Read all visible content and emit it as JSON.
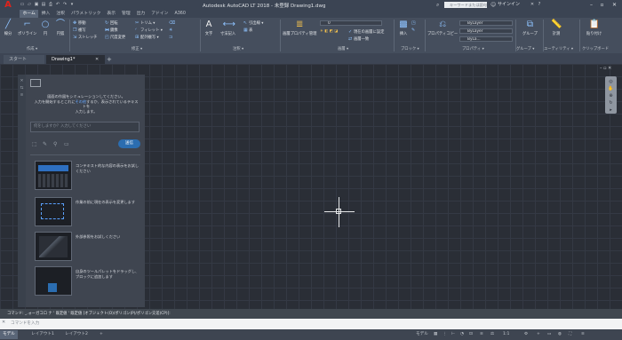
{
  "app": {
    "title": "Autodesk AutoCAD LT 2018 - 未登録  Drawing1.dwg",
    "search_placeholder": "キーワードまたは語句を入力",
    "signin": "サインイン",
    "colors": {
      "titlebar": "#3b4453",
      "ribbon": "#454e5d",
      "canvas": "#2a2e36",
      "accent": "#2b6db0",
      "logo": "#e0231c"
    }
  },
  "ribbon_tabs": [
    "ホーム",
    "挿入",
    "注釈",
    "パラメトリック",
    "表示",
    "管理",
    "出力",
    "アドイン",
    "A360"
  ],
  "ribbon": {
    "draw": {
      "title": "作成 ▾",
      "line": "線分",
      "polyline": "ポリライン",
      "circle": "円",
      "arc": "円弧"
    },
    "modify": {
      "title": "修正 ▾",
      "items": [
        "移動",
        "回転",
        "トリム ▾",
        "複写",
        "鏡像",
        "フィレット ▾",
        "ストレッチ",
        "尺度変更",
        "配列複写 ▾"
      ]
    },
    "annotation": {
      "title": "注釈 ▾",
      "text": "文字",
      "dimension": "寸法記入",
      "items": [
        "引出線 ▾",
        "表"
      ]
    },
    "layers": {
      "title": "画層 ▾",
      "layer_properties": "画層プロパティ管理",
      "current_layer": "0",
      "items": [
        "現在の画層に設定",
        "画層一致"
      ]
    },
    "block": {
      "title": "ブロック ▾",
      "insert": "挿入"
    },
    "properties": {
      "title": "プロパティ ▾",
      "match": "プロパティコピー",
      "bylayer_color": "ByLayer",
      "bylayer_lt": "ByLayer",
      "bylayer_lw": "ByLa..."
    },
    "groups": {
      "title": "グループ ▾",
      "group": "グループ"
    },
    "utilities": {
      "title": "ユーティリティ ▾",
      "measure": "計測"
    },
    "clipboard": {
      "title": "クリップボード",
      "paste": "貼り付け"
    }
  },
  "doc_tabs": {
    "start": "スタート",
    "drawing": "Drawing1*"
  },
  "palette": {
    "prompt_a": "図面の作図をシミュレーションしてください。",
    "prompt_b": "入力を開始するとこれに",
    "prompt_link": "その他",
    "prompt_c": "するか、表示されているテキストを",
    "prompt_d": "入力します。",
    "input_placeholder": "何をしますか？入力してください",
    "send": "送信",
    "cards": [
      {
        "text": "コンテキスト的な内容の表示をお試しください"
      },
      {
        "text": "作業の前に現在の表示を変更します"
      },
      {
        "text": "外部参照をお試しください"
      },
      {
        "text": "自身のツールパレットをドラッグし、ブロックに追加します"
      }
    ]
  },
  "command": {
    "history": "コマンド: _.ォーガコロ  ナ  ' 既定値  ' 既定値 [オブジェクト(O)/ポリゴン(P)/ポリゴン交差(CP)]:",
    "input_placeholder": "コマンドを入力"
  },
  "status": {
    "model": "モデル",
    "layout1": "レイアウト1",
    "layout2": "レイアウト2",
    "mode": "モデル",
    "scale": "1:1"
  }
}
